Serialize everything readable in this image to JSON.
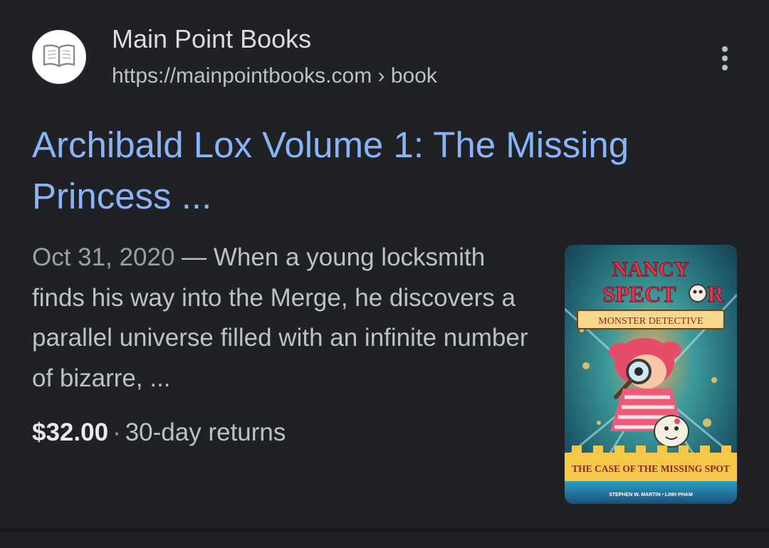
{
  "result": {
    "site_name": "Main Point Books",
    "url": "https://mainpointbooks.com",
    "breadcrumb": "book",
    "title": "Archibald Lox Volume 1: The Missing Princess ...",
    "date": "Oct 31, 2020",
    "snippet": "When a young locksmith finds his way into the Merge, he discovers a parallel universe filled with an infinite number of bizarre, ...",
    "price": "$32.00",
    "returns": "30-day returns",
    "favicon_icon": "open-book-icon",
    "menu_icon": "more-vert-icon"
  },
  "cover": {
    "title_line1": "NANCY",
    "title_line2": "SPECT",
    "title_line3": "R",
    "banner": "MONSTER DETECTIVE",
    "subtitle": "THE CASE OF THE MISSING SPOT",
    "authors": "STEPHEN W. MARTIN • LINH PHAM"
  },
  "colors": {
    "background": "#202124",
    "link": "#8ab4f8",
    "text": "#bdc1c6",
    "price": "#e8eaed"
  }
}
